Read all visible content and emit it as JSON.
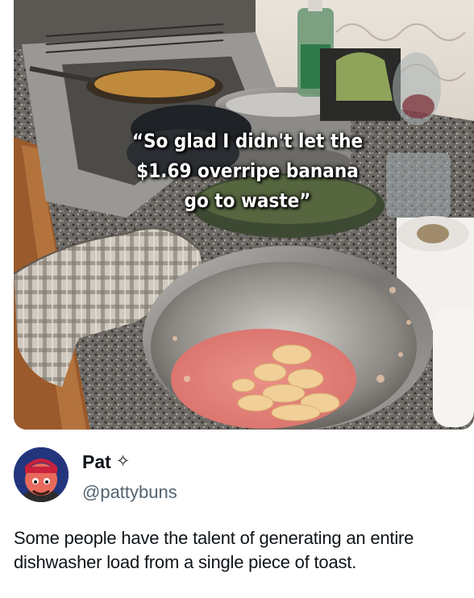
{
  "image_caption": {
    "text": "“So glad I didn't let the\n$1.69 overripe banana\ngo to waste”"
  },
  "author": {
    "display_name": "Pat",
    "badge_icon": "four-point-star-icon",
    "handle": "@pattybuns"
  },
  "tweet": {
    "text": "Some people have the talent of generating an entire dishwasher load from a single piece of toast."
  },
  "colors": {
    "text_primary": "#0f1419",
    "text_secondary": "#536471",
    "background": "#ffffff"
  }
}
